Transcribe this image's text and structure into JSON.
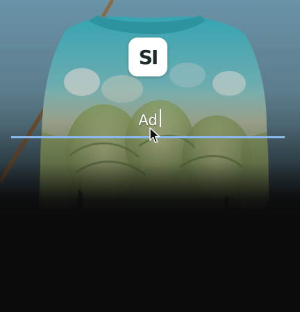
{
  "name_input": {
    "value": "Ad",
    "accent_color": "#8ab8f0"
  },
  "logo": {
    "text": "SI"
  },
  "icons": [
    "logo-icon",
    "mouse-pointer-icon"
  ]
}
